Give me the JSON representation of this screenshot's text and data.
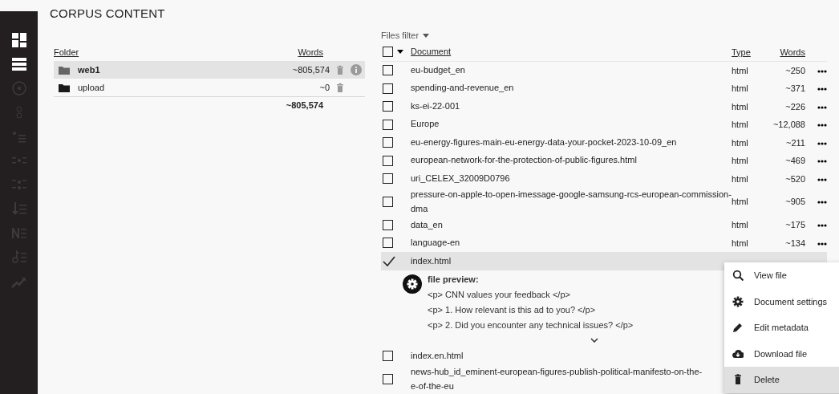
{
  "sidebar": {
    "items": [
      {
        "kind": "dashboard",
        "enabled": true
      },
      {
        "kind": "list",
        "enabled": true
      },
      {
        "kind": "target",
        "enabled": false
      },
      {
        "kind": "circles",
        "enabled": false
      },
      {
        "kind": "bullet-list",
        "enabled": false
      },
      {
        "kind": "dot-grid",
        "enabled": false
      },
      {
        "kind": "dot-grid-double",
        "enabled": false
      },
      {
        "kind": "arrow-list",
        "enabled": false
      },
      {
        "kind": "letter-list",
        "enabled": false
      },
      {
        "kind": "key-list",
        "enabled": false
      },
      {
        "kind": "trend",
        "enabled": false
      }
    ]
  },
  "title": "CORPUS CONTENT",
  "folders": {
    "columns": [
      "Folder",
      "Words"
    ],
    "rows": [
      {
        "name": "web1",
        "words": "~805,574",
        "selected": true
      },
      {
        "name": "upload",
        "words": "~0",
        "selected": false
      }
    ],
    "total": "~805,574"
  },
  "files": {
    "filter": "Files filter",
    "columns": [
      "Document",
      "Type",
      "Words"
    ],
    "all_checked": false,
    "rows": [
      {
        "name": "eu-budget_en",
        "type": "html",
        "words": "~250",
        "checked": false
      },
      {
        "name": "spending-and-revenue_en",
        "type": "html",
        "words": "~371",
        "checked": false
      },
      {
        "name": "ks-ei-22-001",
        "type": "html",
        "words": "~226",
        "checked": false
      },
      {
        "name": "Europe",
        "type": "html",
        "words": "~12,088",
        "checked": false
      },
      {
        "name": "eu-energy-figures-main-eu-energy-data-your-pocket-2023-10-09_en",
        "type": "html",
        "words": "~211",
        "checked": false
      },
      {
        "name": "european-network-for-the-protection-of-public-figures.html",
        "type": "html",
        "words": "~469",
        "checked": false
      },
      {
        "name": "uri_CELEX_32009D0796",
        "type": "html",
        "words": "~520",
        "checked": false
      },
      {
        "name": "pressure-on-apple-to-open-imessage-google-samsung-rcs-european-commission-dma",
        "type": "html",
        "words": "~905",
        "checked": false
      },
      {
        "name": "data_en",
        "type": "html",
        "words": "~175",
        "checked": false
      },
      {
        "name": "language-en",
        "type": "html",
        "words": "~134",
        "checked": false
      },
      {
        "name": "index.html",
        "checked": true,
        "preview": {
          "title": "file preview:",
          "lines": [
            "<p> CNN values your feedback </p>",
            "<p> 1. How relevant is this ad to you? </p>",
            "<p> 2. Did you encounter any technical issues? </p>"
          ]
        }
      },
      {
        "name": "index.en.html",
        "checked": false
      },
      {
        "name": "news-hub_id_eminent-european-figures-publish-political-manifesto-on-the-",
        "name_cont": "e-of-the-eu",
        "checked": false
      }
    ]
  },
  "menu": {
    "items": [
      {
        "kind": "search",
        "label": "View file",
        "selected": false
      },
      {
        "kind": "settings",
        "label": "Document settings",
        "selected": false
      },
      {
        "kind": "edit",
        "label": "Edit metadata",
        "selected": false
      },
      {
        "kind": "download",
        "label": "Download file",
        "selected": false
      },
      {
        "kind": "delete",
        "label": "Delete",
        "selected": true
      }
    ]
  }
}
